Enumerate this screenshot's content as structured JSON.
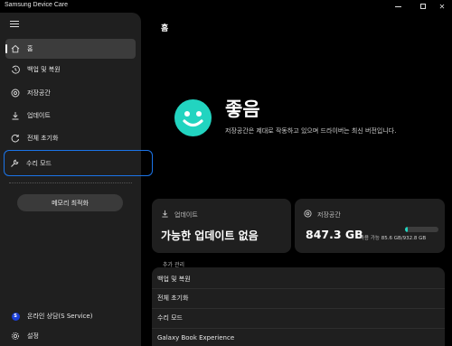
{
  "window": {
    "title": "Samsung Device Care"
  },
  "sidebar": {
    "items": [
      {
        "label": "홈",
        "icon": "home-icon"
      },
      {
        "label": "백업 및 복원",
        "icon": "history-icon"
      },
      {
        "label": "저장공간",
        "icon": "storage-icon"
      },
      {
        "label": "업데이트",
        "icon": "download-icon"
      },
      {
        "label": "전체 초기화",
        "icon": "reset-icon"
      },
      {
        "label": "수리 모드",
        "icon": "wrench-icon"
      }
    ],
    "memory_button": "메모리 최적화",
    "footer": [
      {
        "label": "온라인 상담(S Service)",
        "icon": "s-service-icon"
      },
      {
        "label": "설정",
        "icon": "gear-icon"
      }
    ]
  },
  "main": {
    "title": "홈",
    "status_title": "좋음",
    "status_desc": "저장공간은 제대로 작동하고 있으며 드라이버는 최신 버전입니다.",
    "status_color": "#22d4c0",
    "update_card": {
      "label": "업데이트",
      "value": "가능한 업데이트 없음"
    },
    "storage_card": {
      "label": "저장공간",
      "value": "847.3 GB",
      "avail_label": "사용 가능",
      "used": "85.6 GB",
      "total": "/932.8 GB",
      "used_fraction": 0.092
    },
    "more_header": "추가 관리",
    "more_items": [
      "백업 및 복원",
      "전체 초기화",
      "수리 모드",
      "Galaxy Book Experience"
    ]
  }
}
